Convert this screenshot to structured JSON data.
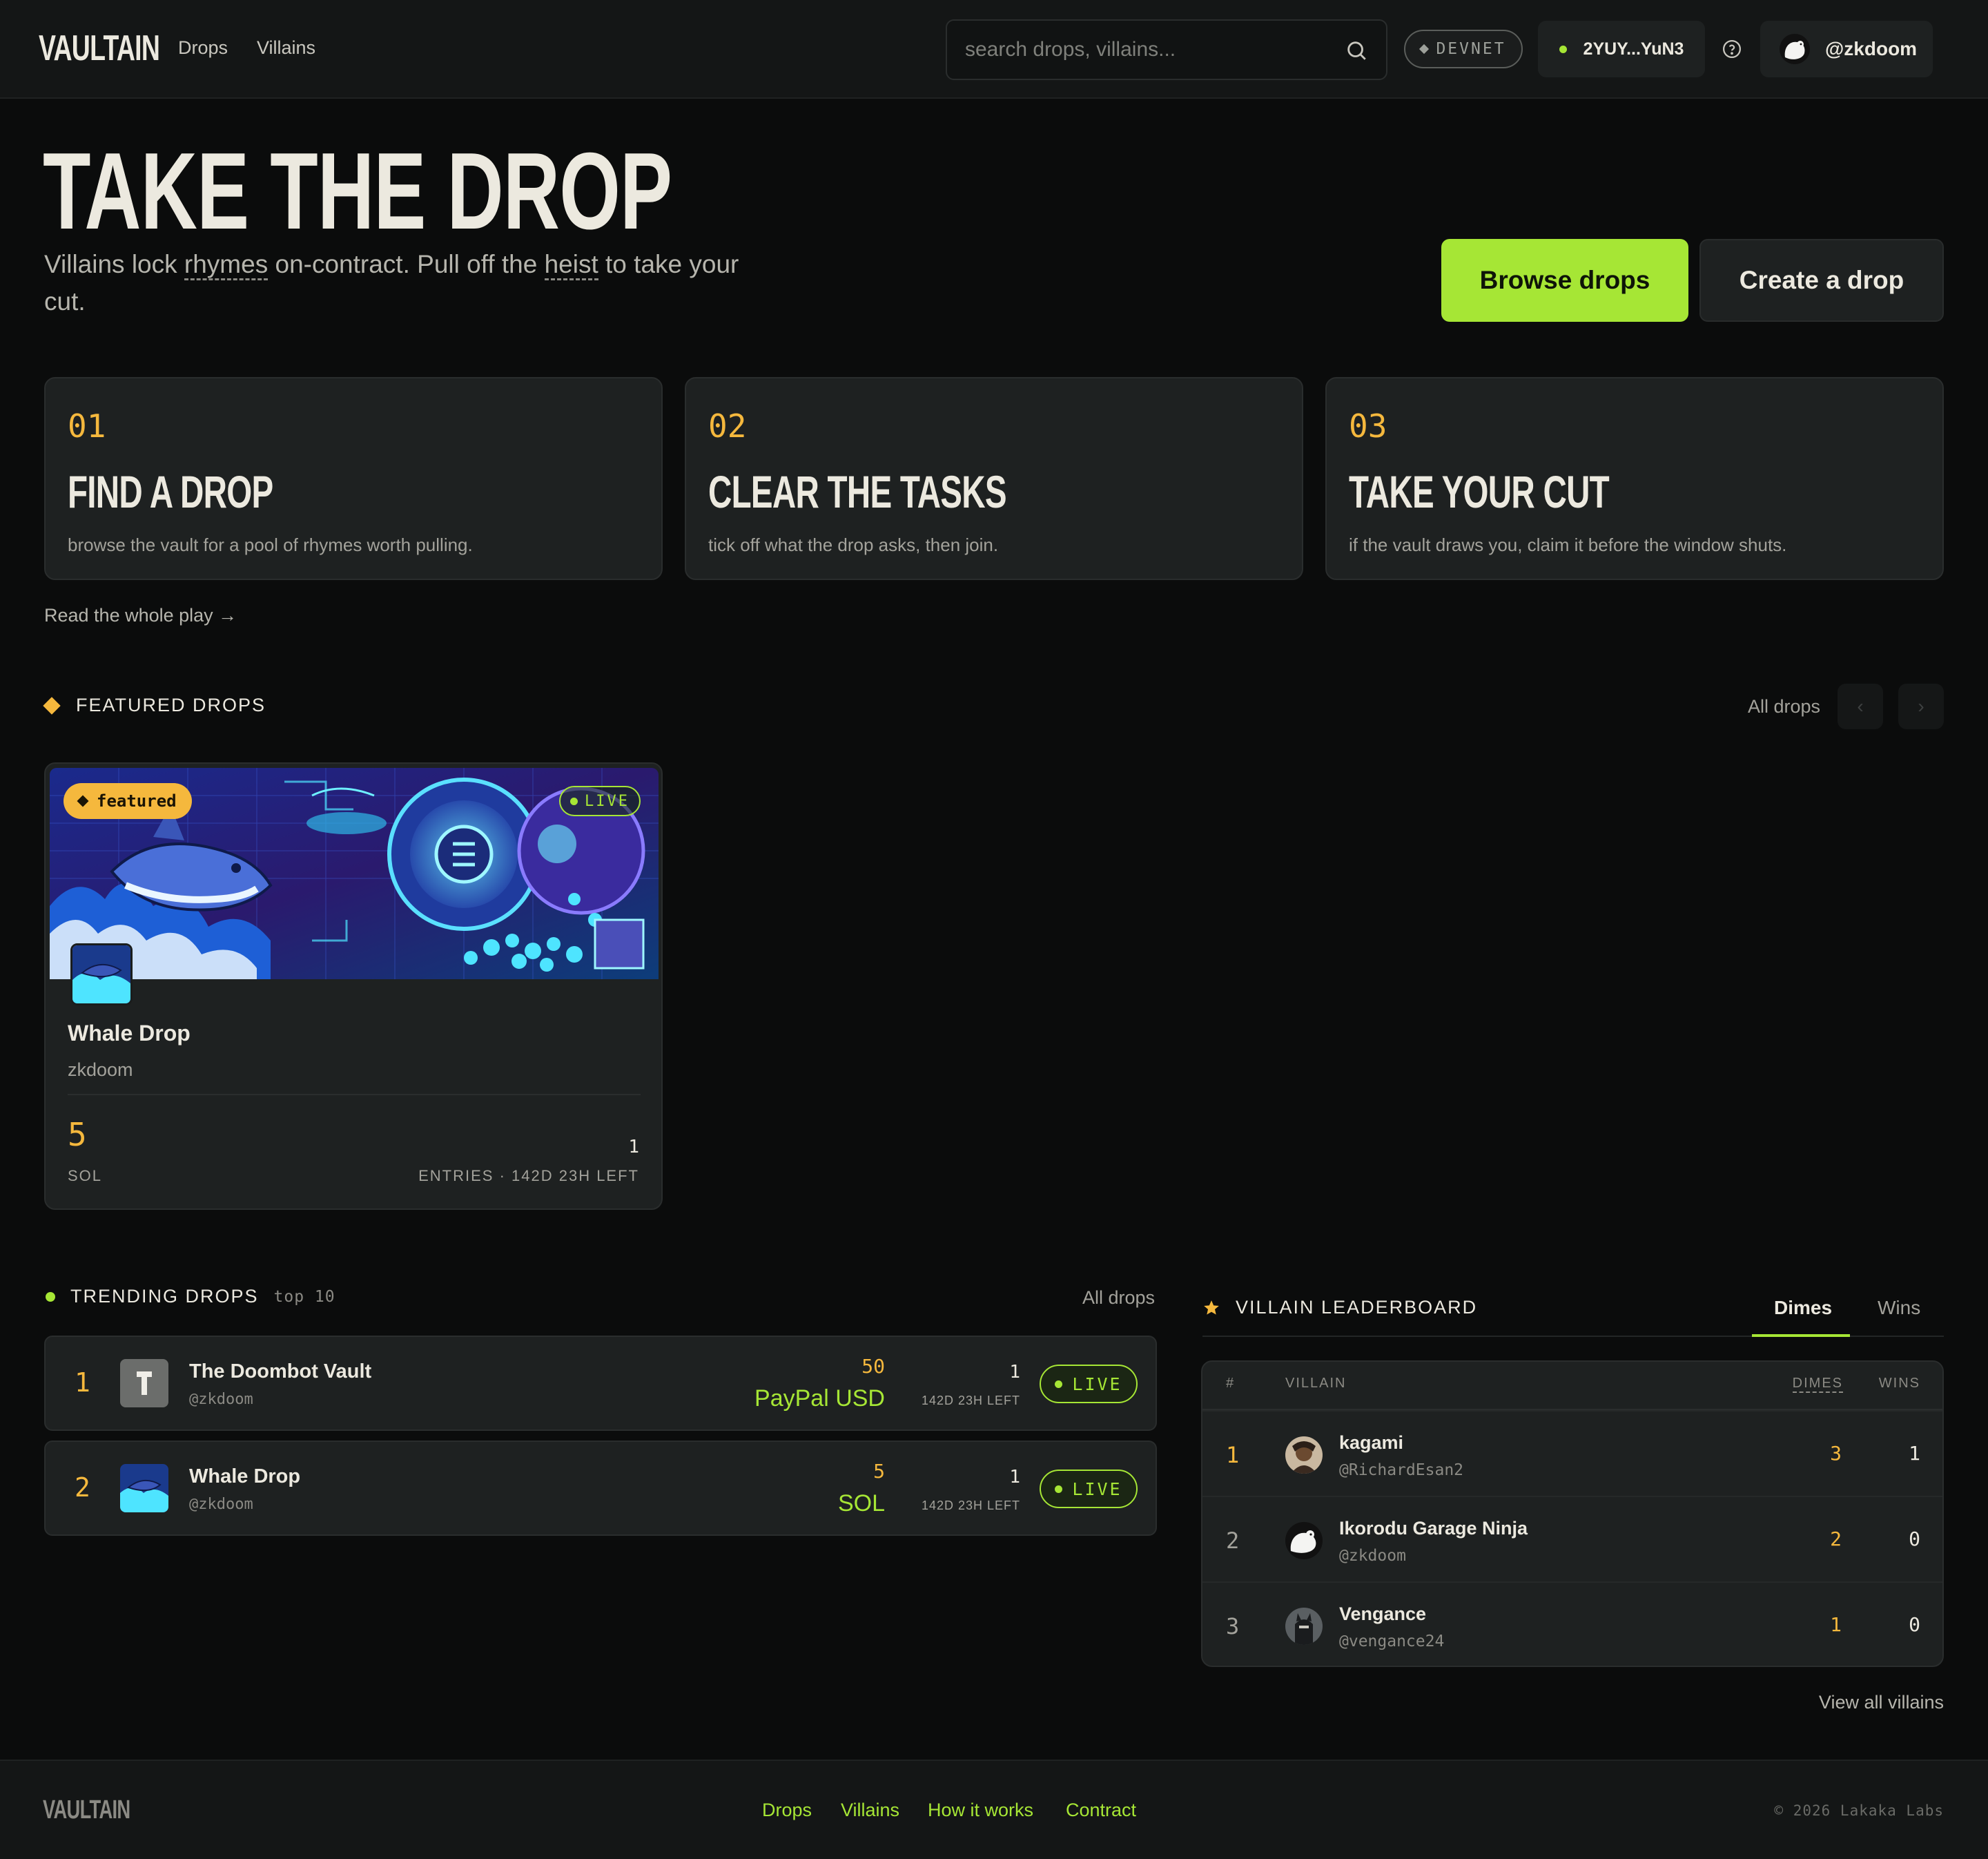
{
  "header": {
    "logo": "VAULTAIN",
    "nav": [
      "Drops",
      "Villains"
    ],
    "search_placeholder": "search drops, villains...",
    "network_badge": "DEVNET",
    "wallet": "2YUY...YuN3",
    "username": "@zkdoom"
  },
  "hero": {
    "title": "TAKE THE DROP",
    "subtitle_parts": [
      "Villains lock ",
      "rhymes",
      " on-contract. Pull off the ",
      "heist",
      " to take your cut."
    ],
    "primary_cta": "Browse drops",
    "secondary_cta": "Create a drop"
  },
  "steps": [
    {
      "num": "01",
      "title": "FIND A DROP",
      "desc": "browse the vault for a pool of rhymes worth pulling."
    },
    {
      "num": "02",
      "title": "CLEAR THE TASKS",
      "desc": "tick off what the drop asks, then join."
    },
    {
      "num": "03",
      "title": "TAKE YOUR CUT",
      "desc": "if the vault draws you, claim it before the window shuts."
    }
  ],
  "read_play": "Read the whole play →",
  "featured": {
    "heading": "FEATURED DROPS",
    "all_link": "All drops",
    "prev": "‹",
    "next": "›",
    "card": {
      "badge": "featured",
      "status": "LIVE",
      "title": "Whale Drop",
      "creator": "zkdoom",
      "amount": "5",
      "currency": "SOL",
      "entries": "1",
      "entries_label": "ENTRIES · 142D 23H LEFT"
    }
  },
  "trending": {
    "heading": "TRENDING DROPS",
    "tag": "top 10",
    "all_link": "All drops",
    "rows": [
      {
        "rank": "1",
        "name": "The Doombot Vault",
        "handle": "@zkdoom",
        "amount": "50",
        "currency": "PayPal USD",
        "entries": "1",
        "time_left": "142D 23H LEFT",
        "status": "LIVE"
      },
      {
        "rank": "2",
        "name": "Whale Drop",
        "handle": "@zkdoom",
        "amount": "5",
        "currency": "SOL",
        "entries": "1",
        "time_left": "142D 23H LEFT",
        "status": "LIVE"
      }
    ]
  },
  "leaderboard": {
    "heading": "VILLAIN LEADERBOARD",
    "tabs": [
      "Dimes",
      "Wins"
    ],
    "columns": [
      "#",
      "VILLAIN",
      "DIMES",
      "WINS"
    ],
    "rows": [
      {
        "rank": "1",
        "name": "kagami",
        "handle": "@RichardEsan2",
        "dimes": "3",
        "wins": "1"
      },
      {
        "rank": "2",
        "name": "Ikorodu Garage Ninja",
        "handle": "@zkdoom",
        "dimes": "2",
        "wins": "0"
      },
      {
        "rank": "3",
        "name": "Vengance",
        "handle": "@vengance24",
        "dimes": "1",
        "wins": "0"
      }
    ],
    "view_all": "View all villains"
  },
  "footer": {
    "logo": "VAULTAIN",
    "links": [
      "Drops",
      "Villains",
      "How it works",
      "Contract"
    ],
    "copyright": "© 2026 Lakaka Labs"
  },
  "colors": {
    "accent": "#a6e635",
    "gold": "#f5b83d",
    "bg": "#0b0c0c",
    "card": "#1e2121"
  }
}
